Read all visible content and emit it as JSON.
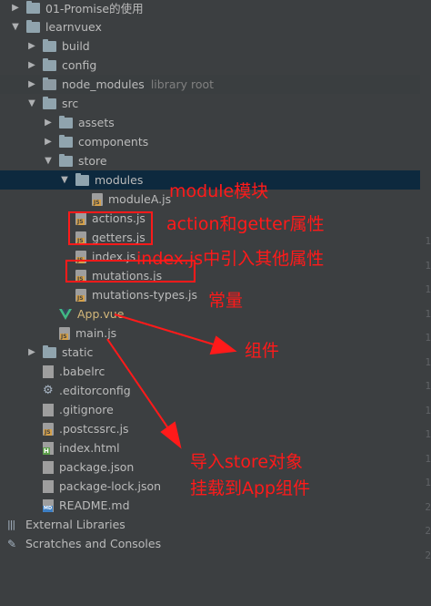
{
  "tree": [
    {
      "label": "01-Promise的使用",
      "type": "folder",
      "arrow": "▶",
      "depth": 1
    },
    {
      "label": "learnvuex",
      "type": "folder",
      "arrow": "▼",
      "depth": 1
    },
    {
      "label": "build",
      "type": "folder",
      "arrow": "▶",
      "depth": 2
    },
    {
      "label": "config",
      "type": "folder",
      "arrow": "▶",
      "depth": 2
    },
    {
      "label": "node_modules",
      "type": "folder-lib",
      "arrow": "▶",
      "depth": 2,
      "hint": "library root"
    },
    {
      "label": "src",
      "type": "folder",
      "arrow": "▼",
      "depth": 2
    },
    {
      "label": "assets",
      "type": "folder",
      "arrow": "▶",
      "depth": 3
    },
    {
      "label": "components",
      "type": "folder",
      "arrow": "▶",
      "depth": 3
    },
    {
      "label": "store",
      "type": "folder",
      "arrow": "▼",
      "depth": 3
    },
    {
      "label": "modules",
      "type": "folder",
      "arrow": "▼",
      "depth": 4
    },
    {
      "label": "moduleA.js",
      "type": "js",
      "depth": 5
    },
    {
      "label": "actions.js",
      "type": "js",
      "depth": 4
    },
    {
      "label": "getters.js",
      "type": "js",
      "depth": 4
    },
    {
      "label": "index.js",
      "type": "js",
      "depth": 4
    },
    {
      "label": "mutations.js",
      "type": "js",
      "depth": 4
    },
    {
      "label": "mutations-types.js",
      "type": "js",
      "depth": 4
    },
    {
      "label": "App.vue",
      "type": "vue",
      "depth": 3
    },
    {
      "label": "main.js",
      "type": "js",
      "depth": 3
    },
    {
      "label": "static",
      "type": "folder",
      "arrow": "▶",
      "depth": 2
    },
    {
      "label": ".babelrc",
      "type": "file",
      "depth": 2
    },
    {
      "label": ".editorconfig",
      "type": "gear",
      "depth": 2
    },
    {
      "label": ".gitignore",
      "type": "file",
      "depth": 2
    },
    {
      "label": ".postcssrc.js",
      "type": "js",
      "depth": 2
    },
    {
      "label": "index.html",
      "type": "html",
      "depth": 2
    },
    {
      "label": "package.json",
      "type": "file",
      "depth": 2
    },
    {
      "label": "package-lock.json",
      "type": "file",
      "depth": 2
    },
    {
      "label": "README.md",
      "type": "md",
      "depth": 2
    },
    {
      "label": "External Libraries",
      "type": "libs",
      "depth": 0
    },
    {
      "label": "Scratches and Consoles",
      "type": "scratch",
      "depth": 0
    }
  ],
  "annotations": {
    "module_label": "module模块",
    "action_getter_label": "action和getter属性",
    "index_label": "index.js中引入其他属性",
    "constant_label": "常量",
    "component_label": "组件",
    "import_store_label_line1": "导入store对象",
    "import_store_label_line2": "挂载到App组件"
  },
  "gutter": {
    "digits": [
      "1",
      "1",
      "1",
      "1",
      "1",
      "1",
      "1",
      "1",
      "1",
      "1",
      "1",
      "2",
      "2",
      "2"
    ]
  },
  "colors": {
    "background": "#3c3f41",
    "selected_row": "#0d293e",
    "annotation": "#ff1a1a",
    "text": "#bbbbbb",
    "hint": "#808080"
  }
}
